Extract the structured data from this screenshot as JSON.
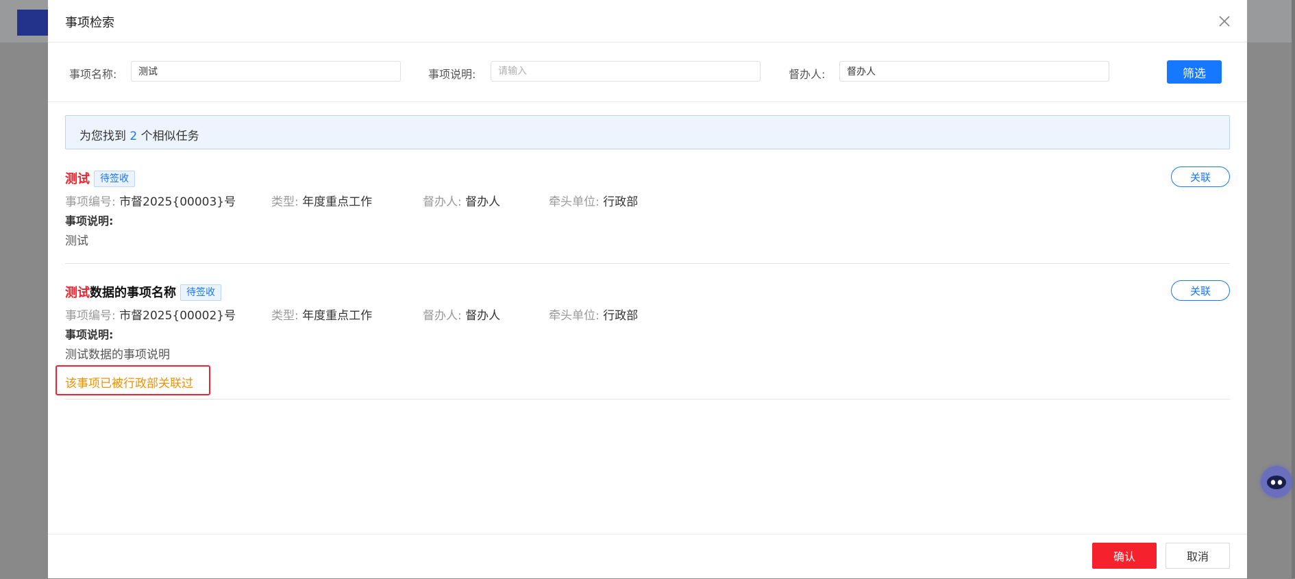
{
  "dialog": {
    "title": "事项检索"
  },
  "filters": {
    "name_label": "事项名称:",
    "name_value": "测试",
    "desc_label": "事项说明:",
    "desc_placeholder": "请输入",
    "supervisor_label": "督办人:",
    "supervisor_value": "督办人",
    "filter_button": "筛选"
  },
  "result": {
    "prefix": "为您找到 ",
    "count": "2",
    "suffix": " 个相似任务"
  },
  "tasks": [
    {
      "title_highlight": "测试",
      "title_rest": "",
      "status": "待签收",
      "link_label": "关联",
      "code_key": "事项编号:",
      "code": "市督2025{00003}号",
      "type_key": "类型:",
      "type": "年度重点工作",
      "supervisor_key": "督办人:",
      "supervisor": "督办人",
      "unit_key": "牵头单位:",
      "unit": "行政部",
      "desc_label": "事项说明:",
      "desc": "测试"
    },
    {
      "title_highlight": "测试",
      "title_rest": "数据的事项名称",
      "status": "待签收",
      "link_label": "关联",
      "code_key": "事项编号:",
      "code": "市督2025{00002}号",
      "type_key": "类型:",
      "type": "年度重点工作",
      "supervisor_key": "督办人:",
      "supervisor": "督办人",
      "unit_key": "牵头单位:",
      "unit": "行政部",
      "desc_label": "事项说明:",
      "desc": "测试数据的事项说明",
      "warning": "该事项已被行政部关联过"
    }
  ],
  "footer": {
    "confirm": "确认",
    "cancel": "取消"
  },
  "colors": {
    "primary": "#1677ff",
    "danger": "#f5222d",
    "warning": "#f29100"
  },
  "icons": [
    "close-icon",
    "assistant-robot-icon"
  ]
}
